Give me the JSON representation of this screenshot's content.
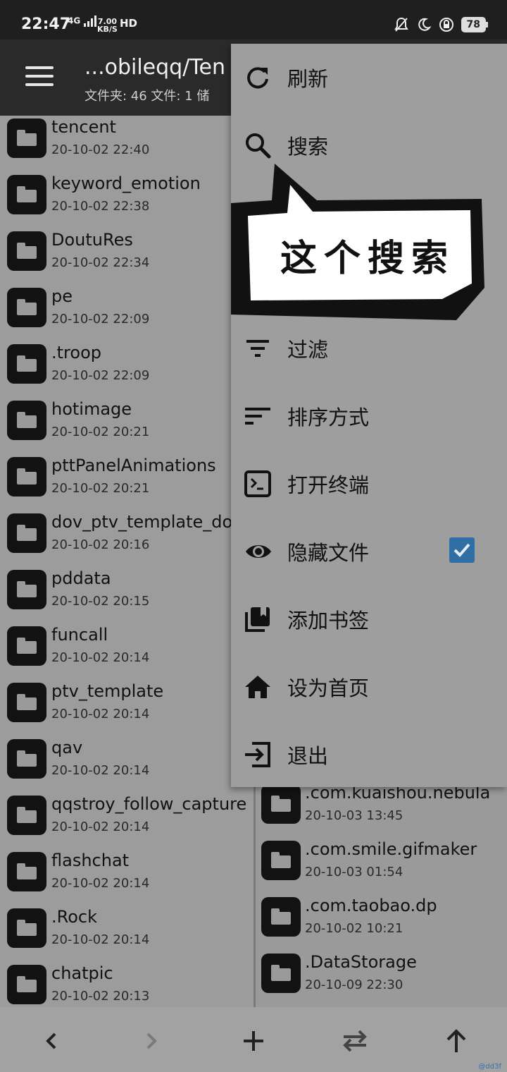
{
  "status_bar": {
    "time": "22:47",
    "network_top": "ⁿ⁴ᴳ",
    "network": "4G",
    "speed_value": "7.00",
    "speed_unit": "KB/S",
    "hd": "HD",
    "battery": "78"
  },
  "app_bar": {
    "title": "...obileqq/Ten",
    "subtitle": "文件夹: 46  文件: 1  储"
  },
  "left_files": [
    {
      "name": "tencent",
      "date": "20-10-02 22:40"
    },
    {
      "name": "keyword_emotion",
      "date": "20-10-02 22:38"
    },
    {
      "name": "DoutuRes",
      "date": "20-10-02 22:34"
    },
    {
      "name": "pe",
      "date": "20-10-02 22:09"
    },
    {
      "name": ".troop",
      "date": "20-10-02 22:09"
    },
    {
      "name": "hotimage",
      "date": "20-10-02 20:21"
    },
    {
      "name": "pttPanelAnimations",
      "date": "20-10-02 20:21"
    },
    {
      "name": "dov_ptv_template_dov",
      "date": "20-10-02 20:16"
    },
    {
      "name": "pddata",
      "date": "20-10-02 20:15"
    },
    {
      "name": "funcall",
      "date": "20-10-02 20:14"
    },
    {
      "name": "ptv_template",
      "date": "20-10-02 20:14"
    },
    {
      "name": "qav",
      "date": "20-10-02 20:14"
    },
    {
      "name": "qqstroy_follow_capture",
      "date": "20-10-02 20:14"
    },
    {
      "name": "flashchat",
      "date": "20-10-02 20:14"
    },
    {
      "name": ".Rock",
      "date": "20-10-02 20:14"
    },
    {
      "name": "chatpic",
      "date": "20-10-02 20:13"
    }
  ],
  "right_files": [
    {
      "name": ".com.kuaishou.nebula",
      "date": "20-10-03 13:45"
    },
    {
      "name": ".com.smile.gifmaker",
      "date": "20-10-03 01:54"
    },
    {
      "name": ".com.taobao.dp",
      "date": "20-10-02 10:21"
    },
    {
      "name": ".DataStorage",
      "date": "20-10-09 22:30"
    }
  ],
  "menu": {
    "refresh": "刷新",
    "search": "搜索",
    "filter": "过滤",
    "sort": "排序方式",
    "terminal": "打开终端",
    "hidden_files": "隐藏文件",
    "hidden_files_checked": true,
    "add_bookmark": "添加书签",
    "set_home": "设为首页",
    "exit": "退出"
  },
  "annotation": {
    "text": "这个搜索"
  },
  "corner_text": "@dd3f"
}
